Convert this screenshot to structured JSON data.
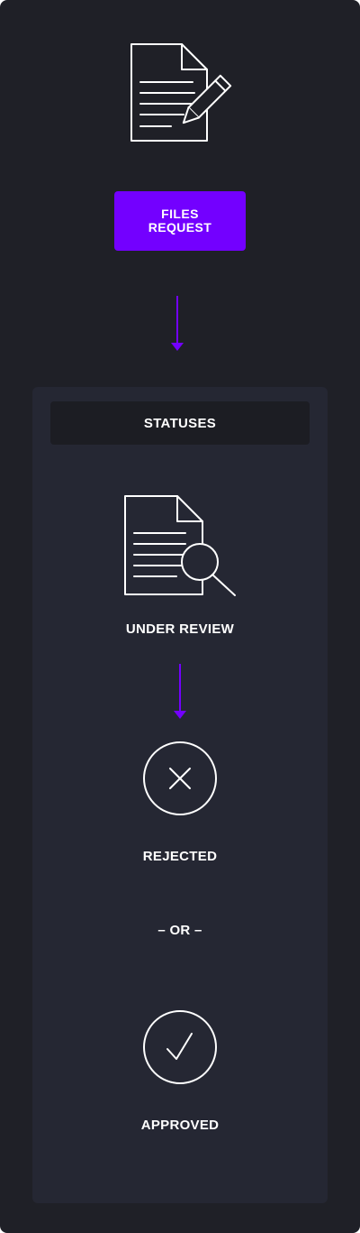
{
  "diagram": {
    "request_button": {
      "line1": "FILES",
      "line2": "REQUEST"
    },
    "statuses_header": "STATUSES",
    "steps": {
      "under_review": "UNDER REVIEW",
      "rejected": "REJECTED",
      "separator": "– OR –",
      "approved": "APPROVED"
    }
  },
  "icons": {
    "top": "document-edit-icon",
    "review": "document-search-icon",
    "rejected": "close-circle-icon",
    "approved": "check-circle-icon",
    "arrows": "arrow-down-icon"
  },
  "colors": {
    "background": "#1f2027",
    "panel": "#252733",
    "panel_header": "#1c1d23",
    "accent": "#7300ff",
    "text": "#ffffff"
  }
}
